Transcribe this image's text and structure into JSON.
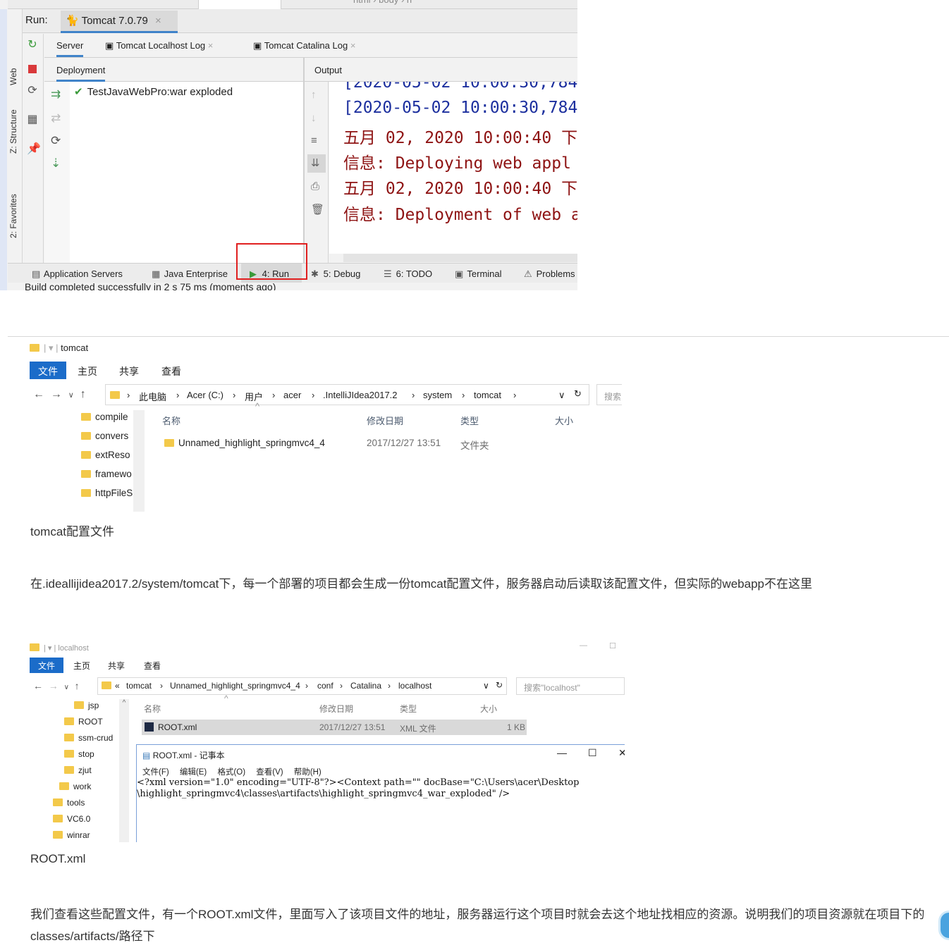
{
  "ide": {
    "breadcrumbs": [
      "html",
      "body",
      "h"
    ],
    "run_label": "Run:",
    "run_tab": "Tomcat 7.0.79",
    "side_labels": [
      "Web",
      "Z: Structure",
      "2: Favorites"
    ],
    "sub_tabs": [
      "Server",
      "Tomcat Localhost Log",
      "Tomcat Catalina Log"
    ],
    "deployment_header": "Deployment",
    "output_header": "Output",
    "deployment_item": "TestJavaWebPro:war exploded",
    "console_lines": [
      {
        "text": "[2020-05-02 10:00:30,784",
        "kind": "blue"
      },
      {
        "text": "[2020-05-02 10:00:30,784",
        "kind": "blue"
      },
      {
        "text": "五月 02, 2020 10:00:40 下",
        "kind": "red"
      },
      {
        "text": "信息: Deploying web appl",
        "kind": "red"
      },
      {
        "text": "五月 02, 2020 10:00:40 下",
        "kind": "red"
      },
      {
        "text": "信息: Deployment of web a",
        "kind": "red"
      }
    ],
    "bottom_tabs": [
      "Application Servers",
      "Java Enterprise",
      "4: Run",
      "5: Debug",
      "6: TODO",
      "Terminal",
      "Problems"
    ],
    "status": "Build completed successfully in 2 s 75 ms (moments ago)"
  },
  "explorer1": {
    "title": "tomcat",
    "ribbon": [
      "文件",
      "主页",
      "共享",
      "查看"
    ],
    "path": [
      "此电脑",
      "Acer (C:)",
      "用户",
      "acer",
      ".IntelliJIdea2017.2",
      "system",
      "tomcat"
    ],
    "search_placeholder": "搜索",
    "tree": [
      "compile",
      "convers",
      "extReso",
      "framewo",
      "httpFileS"
    ],
    "columns": [
      "名称",
      "修改日期",
      "类型",
      "大小"
    ],
    "rows": [
      {
        "name": "Unnamed_highlight_springmvc4_4",
        "date": "2017/12/27 13:51",
        "type": "文件夹",
        "size": ""
      }
    ]
  },
  "caption1": "tomcat配置文件",
  "paragraph1": "在.ideallijidea2017.2/system/tomcat下，每一个部署的项目都会生成一份tomcat配置文件，服务器启动后读取该配置文件，但实际的webapp不在这里",
  "explorer2": {
    "title": "localhost",
    "ribbon": [
      "文件",
      "主页",
      "共享",
      "查看"
    ],
    "path": [
      "tomcat",
      "Unnamed_highlight_springmvc4_4",
      "conf",
      "Catalina",
      "localhost"
    ],
    "search_placeholder": "搜索\"localhost\"",
    "tree": [
      "jsp",
      "ROOT",
      "ssm-crud",
      "stop",
      "zjut",
      "work",
      "tools",
      "VC6.0",
      "winrar"
    ],
    "columns": [
      "名称",
      "修改日期",
      "类型",
      "大小"
    ],
    "rows": [
      {
        "name": "ROOT.xml",
        "date": "2017/12/27 13:51",
        "type": "XML 文件",
        "size": "1 KB"
      }
    ],
    "notepad": {
      "title": "ROOT.xml - 记事本",
      "menu": [
        "文件(F)",
        "编辑(E)",
        "格式(O)",
        "查看(V)",
        "帮助(H)"
      ],
      "line1": "<?xml version=\"1.0\" encoding=\"UTF-8\"?><Context path=\"\" docBase=\"C:\\Users\\acer\\Desktop",
      "line2": "\\highlight_springmvc4\\classes\\artifacts\\highlight_springmvc4_war_exploded\" />"
    }
  },
  "caption2": "ROOT.xml",
  "paragraph2_line1": "我们查看这些配置文件，有一个ROOT.xml文件，里面写入了该项目文件的地址，服务器运行这个项目时就会去这个地址找相应的资源。说明我们的项目资源就在项目下的",
  "paragraph2_line2": "classes/artifacts/路径下",
  "colors": {
    "accent_blue": "#1b6cc9",
    "tab_underline": "#4083c9",
    "highlight_box": "#e02020",
    "console_blue": "#1c2f9e",
    "console_red": "#8e1313"
  }
}
